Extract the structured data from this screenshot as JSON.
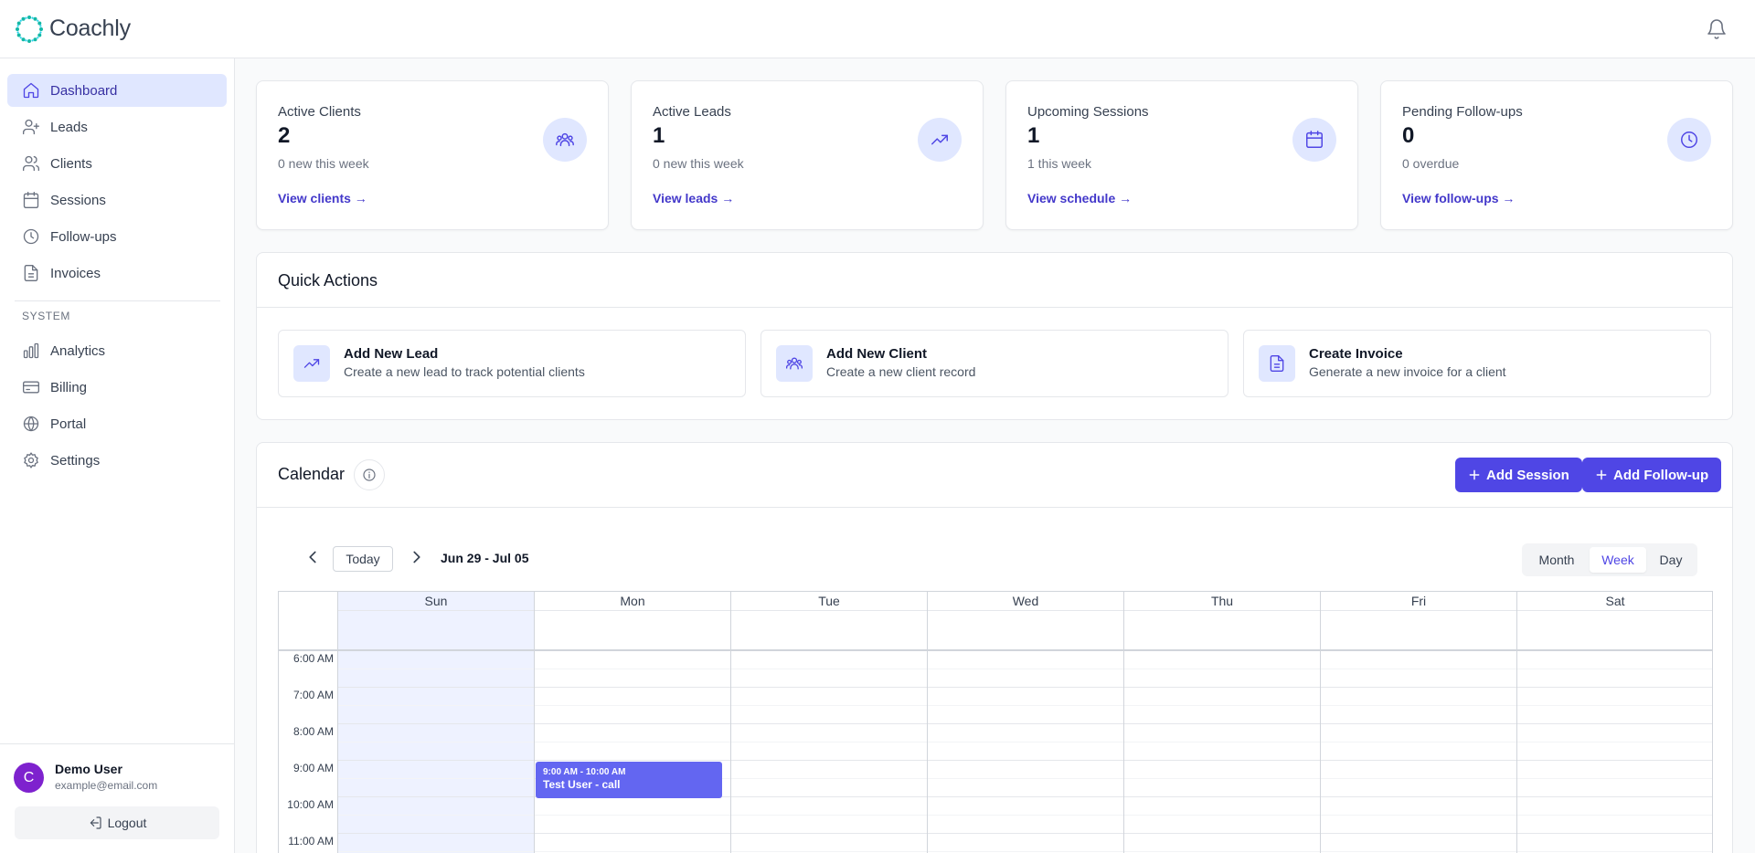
{
  "app": {
    "name": "Coachly"
  },
  "sidebar": {
    "items": [
      {
        "label": "Dashboard",
        "icon": "home-icon",
        "active": true
      },
      {
        "label": "Leads",
        "icon": "user-plus-icon"
      },
      {
        "label": "Clients",
        "icon": "users-icon"
      },
      {
        "label": "Sessions",
        "icon": "calendar-icon"
      },
      {
        "label": "Follow-ups",
        "icon": "clock-icon"
      },
      {
        "label": "Invoices",
        "icon": "document-icon"
      }
    ],
    "system_label": "SYSTEM",
    "system_items": [
      {
        "label": "Analytics",
        "icon": "bar-chart-icon"
      },
      {
        "label": "Billing",
        "icon": "credit-card-icon"
      },
      {
        "label": "Portal",
        "icon": "globe-icon"
      },
      {
        "label": "Settings",
        "icon": "gear-icon"
      }
    ],
    "user": {
      "initial": "C",
      "name": "Demo User",
      "email": "example@email.com"
    },
    "logout_label": "Logout"
  },
  "stats": [
    {
      "label": "Active Clients",
      "value": "2",
      "sub": "0 new this week",
      "link": "View clients →",
      "icon": "users-icon"
    },
    {
      "label": "Active Leads",
      "value": "1",
      "sub": "0 new this week",
      "link": "View leads →",
      "icon": "trending-up-icon"
    },
    {
      "label": "Upcoming Sessions",
      "value": "1",
      "sub": "1 this week",
      "link": "View schedule →",
      "icon": "calendar-icon"
    },
    {
      "label": "Pending Follow-ups",
      "value": "0",
      "sub": "0 overdue",
      "link": "View follow-ups →",
      "icon": "clock-icon"
    }
  ],
  "quick_actions": {
    "title": "Quick Actions",
    "items": [
      {
        "title": "Add New Lead",
        "desc": "Create a new lead to track potential clients",
        "icon": "trending-up-icon"
      },
      {
        "title": "Add New Client",
        "desc": "Create a new client record",
        "icon": "users-icon"
      },
      {
        "title": "Create Invoice",
        "desc": "Generate a new invoice for a client",
        "icon": "document-icon"
      }
    ]
  },
  "calendar": {
    "title": "Calendar",
    "add_session_label": "Add Session",
    "add_followup_label": "Add Follow-up",
    "today_label": "Today",
    "date_range": "Jun 29 - Jul 05",
    "views": [
      "Month",
      "Week",
      "Day"
    ],
    "active_view": "Week",
    "days": [
      "Sun",
      "Mon",
      "Tue",
      "Wed",
      "Thu",
      "Fri",
      "Sat"
    ],
    "times": [
      "6:00 AM",
      "7:00 AM",
      "8:00 AM",
      "9:00 AM",
      "10:00 AM",
      "11:00 AM"
    ],
    "event": {
      "time": "9:00 AM - 10:00 AM",
      "title": "Test User - call",
      "day": "Mon"
    }
  },
  "colors": {
    "accent": "#4f46e5",
    "accent_light": "#e0e7ff",
    "event": "#6366f1",
    "avatar": "#7e22ce"
  }
}
